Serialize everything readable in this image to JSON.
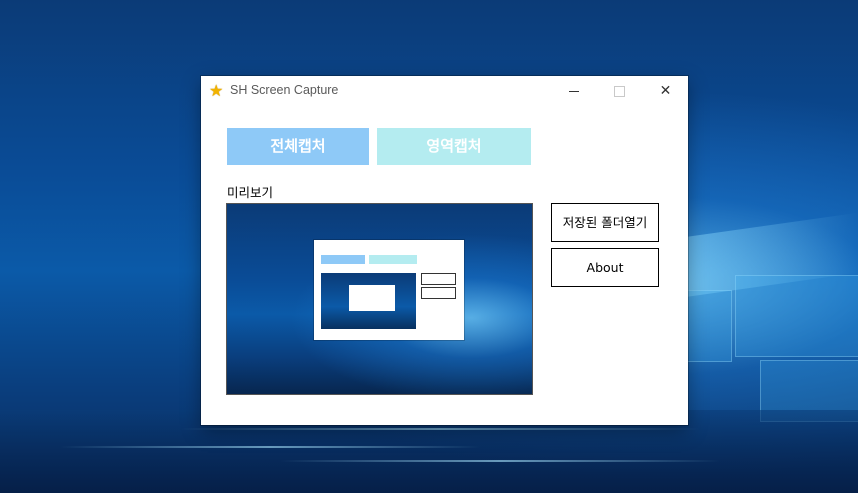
{
  "window": {
    "title": "SH Screen Capture",
    "icon": "star-icon"
  },
  "toolbar": {
    "full_capture_label": "전체캡처",
    "area_capture_label": "영역캡처"
  },
  "preview": {
    "label": "미리보기"
  },
  "side": {
    "open_folder_label": "저장된 폴더열기",
    "about_label": "About"
  },
  "colors": {
    "full_capture_bg": "#8ec9f7",
    "area_capture_bg": "#b4ecf0"
  }
}
